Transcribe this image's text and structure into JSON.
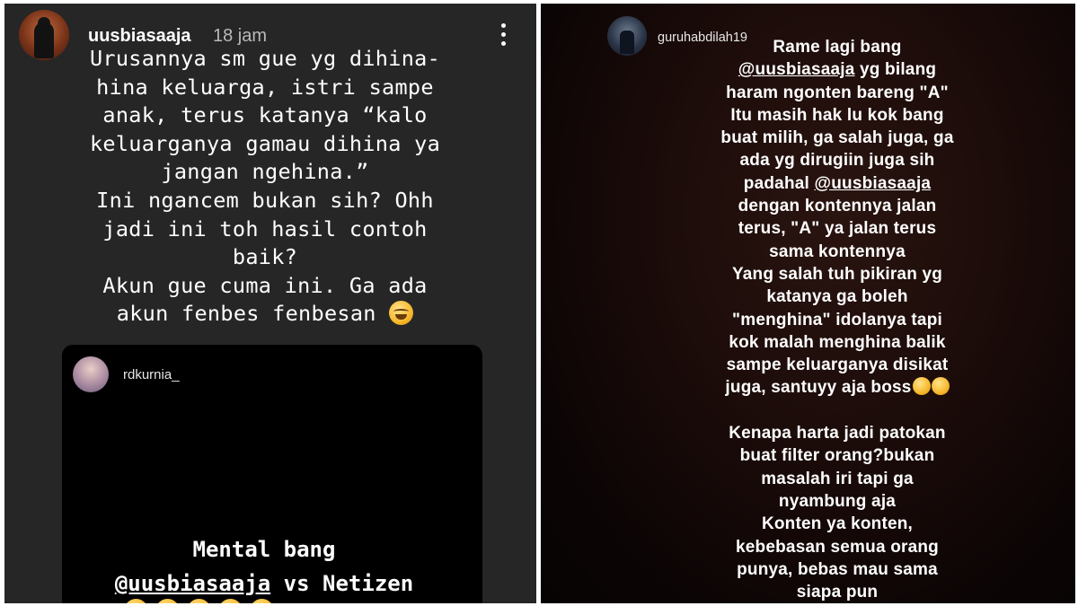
{
  "left_story": {
    "username": "uusbiasaaja",
    "time": "18 jam",
    "caption_lines": [
      "Urusannya sm gue yg dihina-",
      "hina keluarga, istri sampe",
      "anak, terus katanya “kalo",
      "keluarganya gamau dihina ya",
      "jangan ngehina.”",
      "Ini ngancem bukan sih? Ohh",
      "jadi ini toh hasil contoh",
      "baik?",
      "Akun gue cuma ini. Ga ada",
      "akun fenbes fenbesan"
    ],
    "caption_emoji": "face-with-tears-of-joy-emoji",
    "shared_post": {
      "username": "rdkurnia_",
      "line1": "Mental bang",
      "mention": "@uusbiasaaja",
      "line2_rest": " vs Netizen",
      "emojis": [
        "face-with-tears-of-joy-emoji",
        "face-with-tears-of-joy-emoji",
        "face-with-tears-of-joy-emoji",
        "face-with-tears-of-joy-emoji",
        "face-with-tears-of-joy-emoji"
      ]
    }
  },
  "right_story": {
    "username": "guruhabdilah19",
    "lines": [
      "Rame lagi bang",
      "@uusbiasaaja yg bilang",
      "haram ngonten bareng \"A\"",
      "Itu masih hak lu kok bang",
      "buat milih, ga salah juga, ga",
      "ada yg dirugiin juga sih",
      "padahal @uusbiasaaja",
      "dengan kontennya jalan",
      "terus, \"A\" ya jalan terus",
      "sama kontennya",
      "Yang salah tuh pikiran yg",
      "katanya ga boleh",
      "\"menghina\" idolanya tapi",
      "kok malah menghina balik",
      "sampe keluarganya disikat",
      "juga, santuyy aja boss",
      "",
      "Kenapa harta jadi patokan",
      "buat filter orang?bukan",
      "masalah iri tapi ga",
      "nyambung aja",
      "Konten ya konten,",
      "kebebasan semua orang",
      "punya, bebas mau sama",
      "siapa pun"
    ],
    "line16_emoji": "rolling-on-the-floor-laughing-emoji"
  },
  "colors": {
    "left_bg": "#262626",
    "inner_card_bg": "#000000",
    "right_bg": "#1c0c0a",
    "text": "#ffffff"
  }
}
